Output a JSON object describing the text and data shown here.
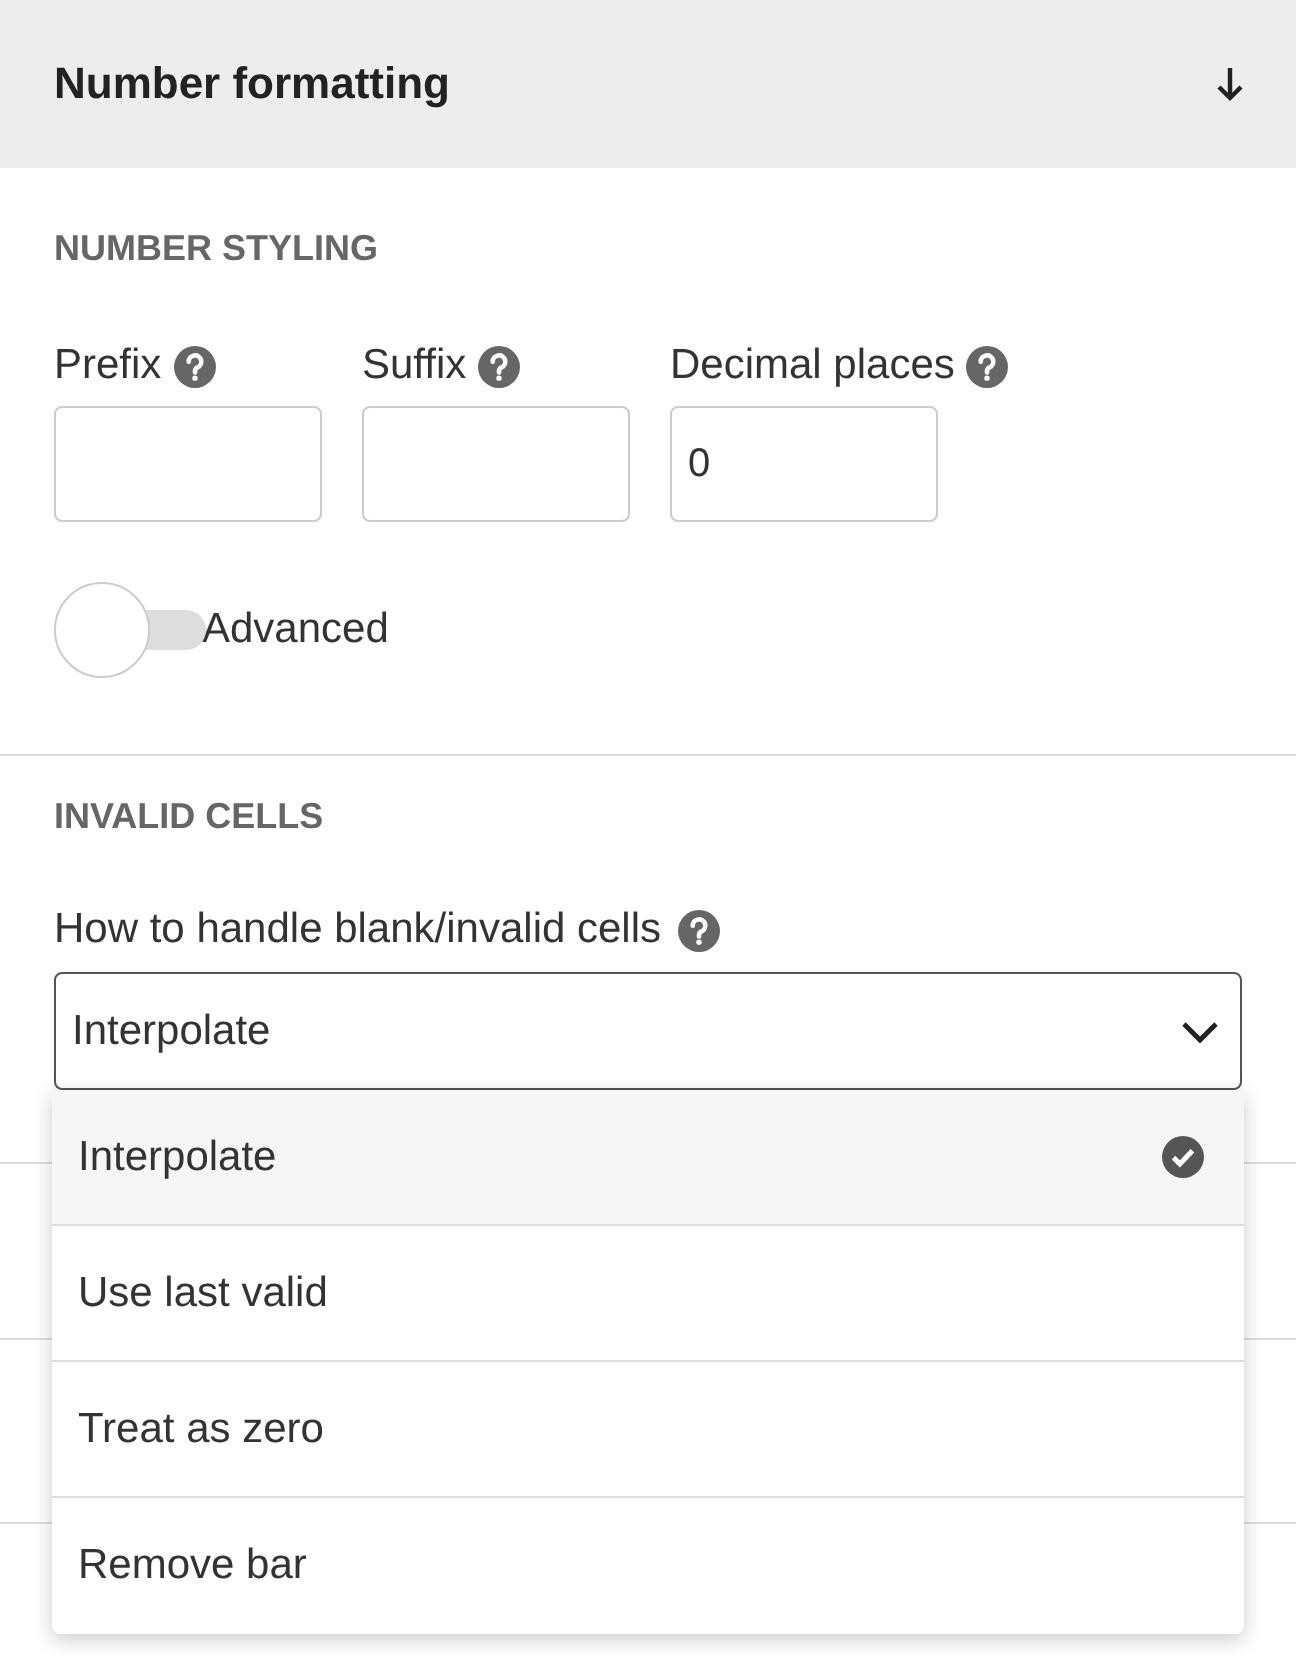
{
  "header": {
    "title": "Number formatting"
  },
  "number_styling": {
    "heading": "NUMBER STYLING",
    "fields": [
      {
        "label": "Prefix"
      },
      {
        "label": "Suffix"
      },
      {
        "label": "Decimal places",
        "value": "0"
      }
    ],
    "advanced": {
      "label": "Advanced",
      "on": false
    }
  },
  "invalid_cells": {
    "heading": "INVALID CELLS",
    "label": "How to handle blank/invalid cells",
    "select": {
      "value": "Interpolate",
      "expanded": true
    },
    "options": [
      {
        "label": "Interpolate",
        "selected": true
      },
      {
        "label": "Use last valid",
        "selected": false
      },
      {
        "label": "Treat as zero",
        "selected": false
      },
      {
        "label": "Remove bar",
        "selected": false
      }
    ]
  }
}
